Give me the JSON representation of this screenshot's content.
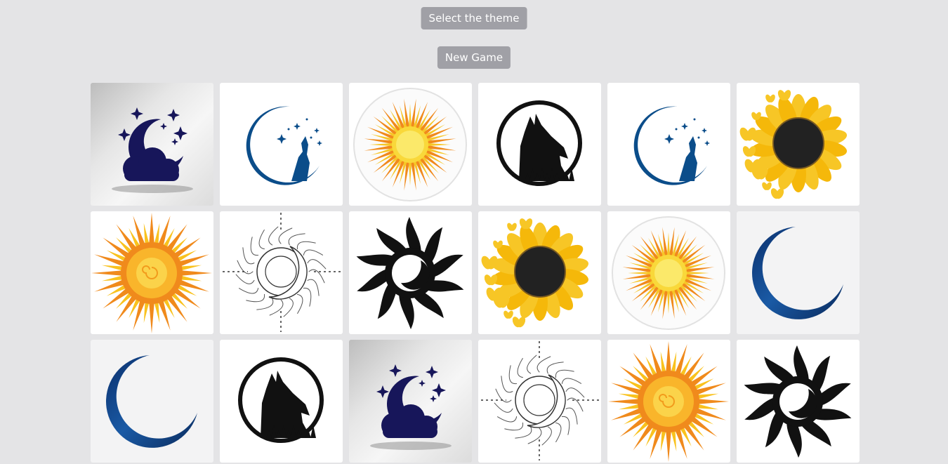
{
  "header": {
    "theme_button_label": "Select the theme",
    "new_game_button_label": "New Game"
  },
  "board": {
    "rows": 3,
    "columns": 6,
    "cards": [
      {
        "image": "moon-clouds-stars-icon"
      },
      {
        "image": "wolf-moon-blue-icon"
      },
      {
        "image": "sun-round-icon"
      },
      {
        "image": "wolf-moon-black-icon"
      },
      {
        "image": "wolf-moon-blue-icon"
      },
      {
        "image": "sunflower-butterflies-icon"
      },
      {
        "image": "sun-orange-swirl-icon"
      },
      {
        "image": "sun-moon-outline-icon"
      },
      {
        "image": "tribal-sun-moon-icon"
      },
      {
        "image": "sunflower-butterflies-icon"
      },
      {
        "image": "sun-round-icon"
      },
      {
        "image": "crescent-moon-blue-icon"
      },
      {
        "image": "crescent-moon-blue-icon"
      },
      {
        "image": "wolf-moon-black-icon"
      },
      {
        "image": "moon-clouds-stars-icon"
      },
      {
        "image": "sun-moon-outline-icon"
      },
      {
        "image": "sun-orange-swirl-icon"
      },
      {
        "image": "tribal-sun-moon-icon"
      }
    ]
  },
  "colors": {
    "background": "#e4e4e6",
    "button": "#a0a0a6",
    "navy": "#17165a",
    "wolf_blue": "#0b4d8a",
    "sun_yellow": "#f7c626",
    "sun_orange": "#f08a1c"
  }
}
